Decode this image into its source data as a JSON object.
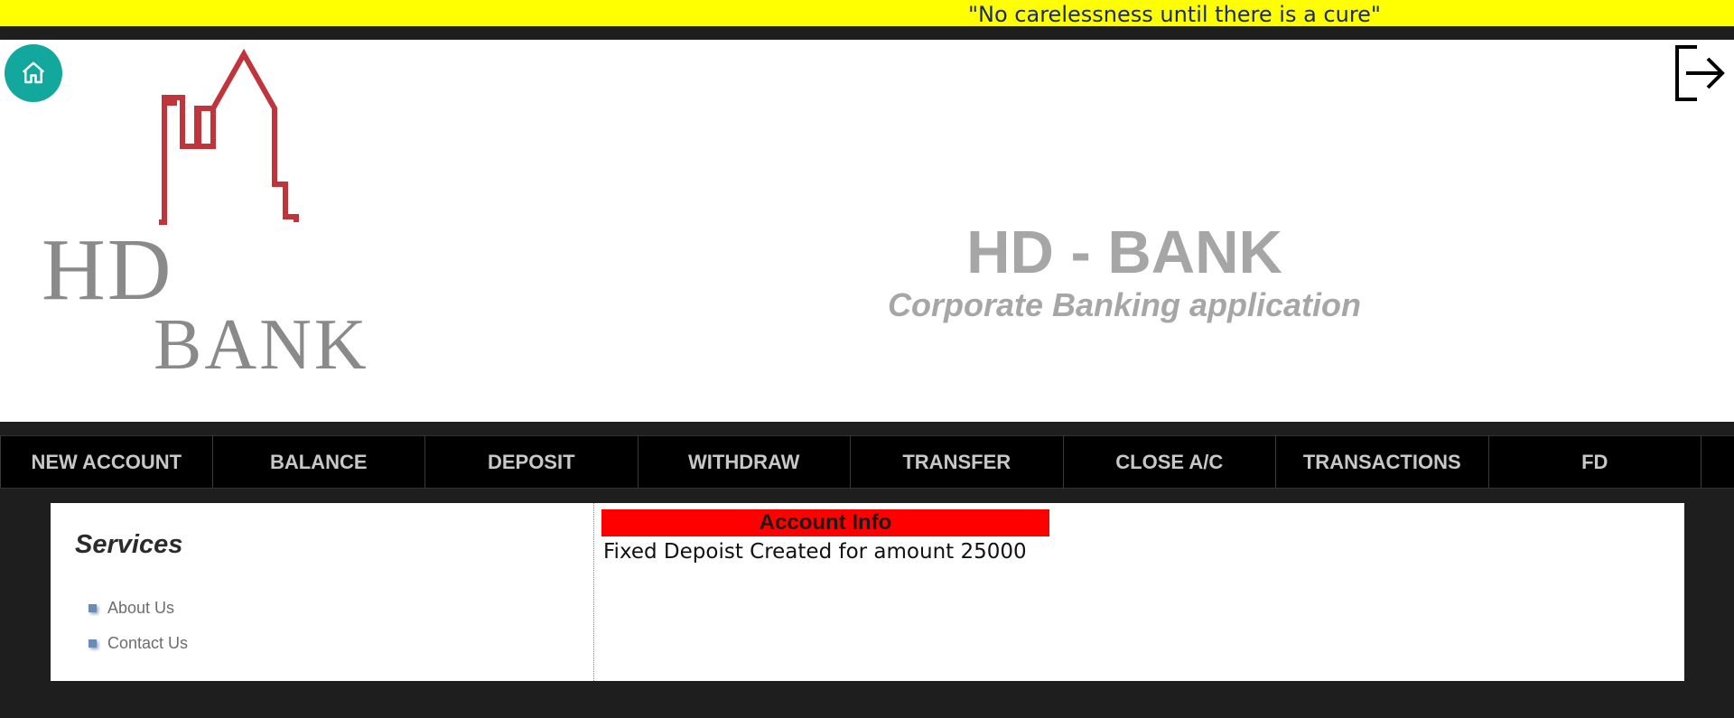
{
  "quote_bar": {
    "text": "\"No carelessness until there is a cure\""
  },
  "header": {
    "logo": {
      "line1": "HD",
      "line2": "BANK"
    },
    "title": "HD - BANK",
    "subtitle": "Corporate Banking application",
    "home_icon": "home-icon",
    "logout_icon": "logout-icon"
  },
  "nav": {
    "items": [
      {
        "label": "NEW ACCOUNT"
      },
      {
        "label": "BALANCE"
      },
      {
        "label": "DEPOSIT"
      },
      {
        "label": "WITHDRAW"
      },
      {
        "label": "TRANSFER"
      },
      {
        "label": "CLOSE A/C"
      },
      {
        "label": "TRANSACTIONS"
      },
      {
        "label": "FD"
      }
    ]
  },
  "sidebar": {
    "title": "Services",
    "links": [
      {
        "label": "About Us"
      },
      {
        "label": "Contact Us"
      }
    ]
  },
  "main": {
    "header": "Account Info",
    "message": "Fixed Depoist Created for amount 25000"
  },
  "colors": {
    "quote_bg": "#ffff00",
    "home_button": "#13a89e",
    "logo_skyline": "#c0343c",
    "info_header_bg": "#ff0000"
  }
}
